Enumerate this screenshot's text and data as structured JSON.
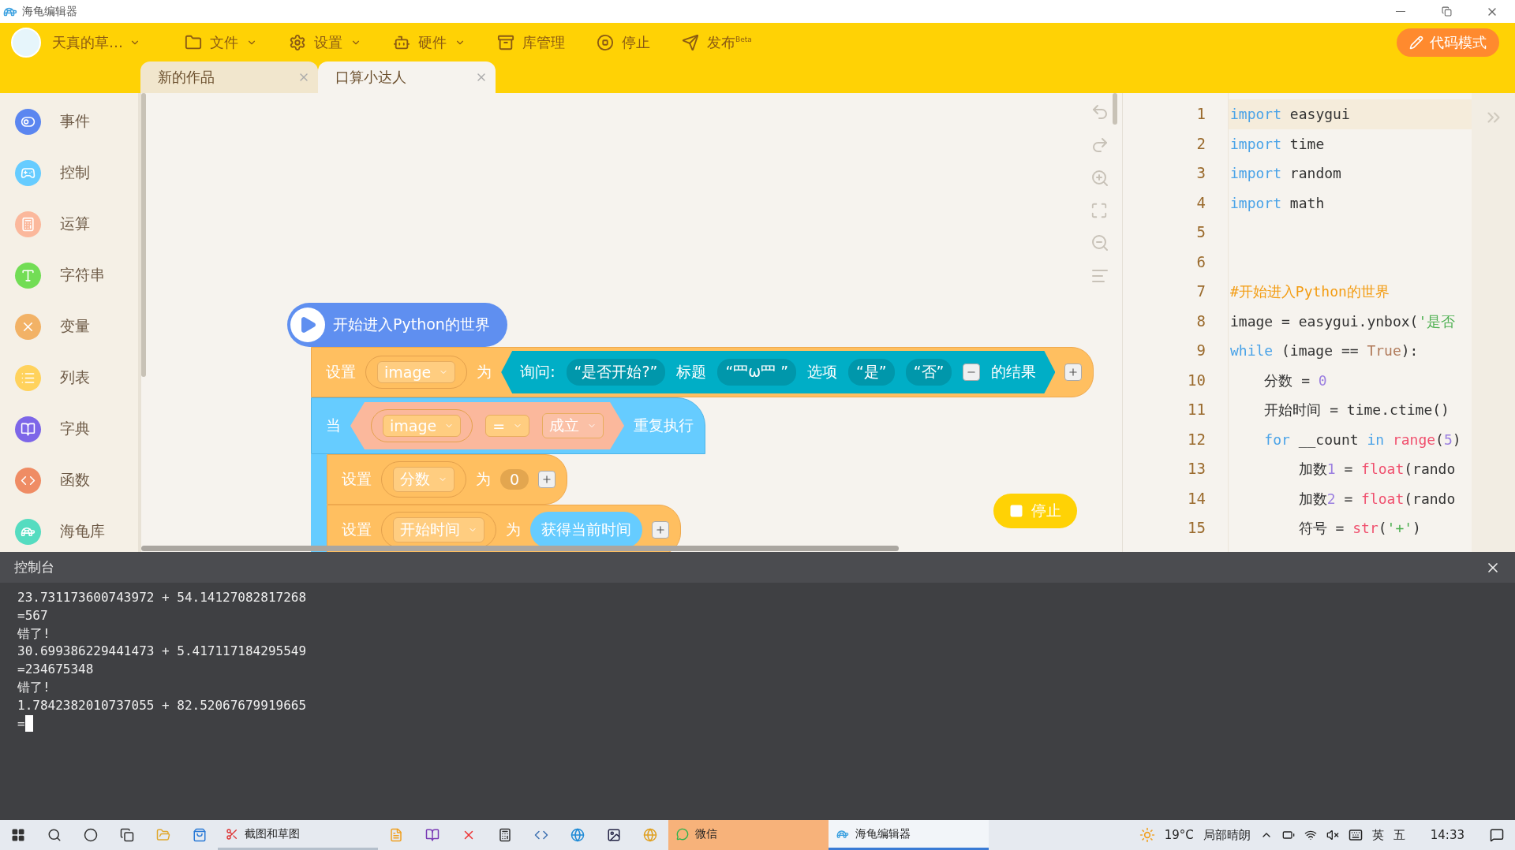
{
  "window": {
    "title": "海龟编辑器"
  },
  "toolbar": {
    "user": "天真的草…",
    "menus": [
      {
        "label": "文件",
        "kind": "dropdown"
      },
      {
        "label": "设置",
        "kind": "dropdown"
      },
      {
        "label": "硬件",
        "kind": "dropdown"
      },
      {
        "label": "库管理",
        "kind": "plain"
      },
      {
        "label": "停止",
        "kind": "plain"
      },
      {
        "label": "发布$^{Beta}$",
        "kind": "plain"
      }
    ],
    "mode_button": "代码模式"
  },
  "tabs": [
    {
      "label": "新的作品",
      "selected": false
    },
    {
      "label": "口算小达人",
      "selected": true
    }
  ],
  "sidebar": {
    "items": [
      {
        "label": "事件",
        "color": "#5b86f0"
      },
      {
        "label": "控制",
        "color": "#66ccff"
      },
      {
        "label": "运算",
        "color": "#fbb89c"
      },
      {
        "label": "字符串",
        "color": "#72dd55"
      },
      {
        "label": "变量",
        "color": "#f2b266"
      },
      {
        "label": "列表",
        "color": "#ffd25c"
      },
      {
        "label": "字典",
        "color": "#7d66e8"
      },
      {
        "label": "函数",
        "color": "#ef8c64"
      },
      {
        "label": "海龟库",
        "color": "#55dcc0"
      }
    ]
  },
  "canvas": {
    "hat": "开始进入Python的世界",
    "set_block": {
      "label": "设置",
      "variable": "image",
      "to": "为",
      "ask": {
        "label": "询问:",
        "prompt": "“是否开始?”",
        "title_label": "标题",
        "title": "“罒ω罒 ”",
        "options_label": "选项",
        "options": [
          "“是”",
          "“否”"
        ],
        "suffix": "的结果"
      }
    },
    "while_block": {
      "label": "当",
      "left": "image",
      "operator": "=",
      "right": "成立",
      "suffix": "重复执行",
      "body": [
        {
          "kind": "number",
          "label": "设置",
          "variable": "分数",
          "to": "为",
          "value": "0"
        },
        {
          "kind": "call",
          "label": "设置",
          "variable": "开始时间",
          "to": "为",
          "value": "获得当前时间"
        }
      ]
    },
    "stop_button": "停止"
  },
  "code": {
    "lines": [
      {
        "number": "1",
        "current": true,
        "tokens": [
          {
            "kind": "keyword",
            "text": "import"
          },
          {
            "kind": "plain",
            "text": " easygui"
          }
        ]
      },
      {
        "number": "2",
        "current": false,
        "tokens": [
          {
            "kind": "keyword",
            "text": "import"
          },
          {
            "kind": "plain",
            "text": " time"
          }
        ]
      },
      {
        "number": "3",
        "current": false,
        "tokens": [
          {
            "kind": "keyword",
            "text": "import"
          },
          {
            "kind": "plain",
            "text": " random"
          }
        ]
      },
      {
        "number": "4",
        "current": false,
        "tokens": [
          {
            "kind": "keyword",
            "text": "import"
          },
          {
            "kind": "plain",
            "text": " math"
          }
        ]
      },
      {
        "number": "5",
        "current": false
      },
      {
        "number": "6",
        "current": false
      },
      {
        "number": "7",
        "current": false,
        "tokens": [
          {
            "kind": "comment",
            "text": "#开始进入Python的世界"
          }
        ]
      },
      {
        "number": "8",
        "current": false,
        "tokens": [
          {
            "kind": "plain",
            "text": "image = easygui.ynbox("
          },
          {
            "kind": "string",
            "text": "'是否"
          }
        ]
      },
      {
        "number": "9",
        "current": false,
        "tokens": [
          {
            "kind": "keyword",
            "text": "while"
          },
          {
            "kind": "plain",
            "text": " (image == "
          },
          {
            "kind": "constant",
            "text": "True"
          },
          {
            "kind": "plain",
            "text": "):"
          }
        ]
      },
      {
        "number": "10",
        "current": false,
        "tokens": [
          {
            "kind": "plain",
            "text": "    分数 = "
          },
          {
            "kind": "number",
            "text": "0"
          }
        ]
      },
      {
        "number": "11",
        "current": false,
        "tokens": [
          {
            "kind": "plain",
            "text": "    开始时间 = time.ctime()"
          }
        ]
      },
      {
        "number": "12",
        "current": false,
        "tokens": [
          {
            "kind": "keyword",
            "text": "    for"
          },
          {
            "kind": "plain",
            "text": " __count "
          },
          {
            "kind": "keyword",
            "text": "in "
          },
          {
            "kind": "builtin",
            "text": "range"
          },
          {
            "kind": "plain",
            "text": "("
          },
          {
            "kind": "number",
            "text": "5"
          },
          {
            "kind": "plain",
            "text": ")"
          }
        ]
      },
      {
        "number": "13",
        "current": false,
        "tokens": [
          {
            "kind": "plain",
            "text": "        加数"
          },
          {
            "kind": "number",
            "text": "1"
          },
          {
            "kind": "plain",
            "text": " = "
          },
          {
            "kind": "builtin",
            "text": "float"
          },
          {
            "kind": "plain",
            "text": "(rando"
          }
        ]
      },
      {
        "number": "14",
        "current": false,
        "tokens": [
          {
            "kind": "plain",
            "text": "        加数"
          },
          {
            "kind": "number",
            "text": "2"
          },
          {
            "kind": "plain",
            "text": " = "
          },
          {
            "kind": "builtin",
            "text": "float"
          },
          {
            "kind": "plain",
            "text": "(rando"
          }
        ]
      },
      {
        "number": "15",
        "current": false,
        "tokens": [
          {
            "kind": "plain",
            "text": "        符号 = "
          },
          {
            "kind": "builtin",
            "text": "str"
          },
          {
            "kind": "plain",
            "text": "("
          },
          {
            "kind": "string",
            "text": "'+'"
          },
          {
            "kind": "plain",
            "text": ")"
          }
        ]
      }
    ]
  },
  "console": {
    "title": "控制台",
    "lines": [
      "23.731173600743972 + 54.14127082817268",
      "=567",
      "错了!",
      "30.699386229441473 + 5.417117184295549",
      "=234675348",
      "错了!",
      "1.7842382010737055 + 82.52067679919665",
      "="
    ]
  },
  "taskbar": {
    "apps": [
      {
        "label": "截图和草图",
        "selected": false,
        "highlighted": false
      },
      {
        "label": "微信",
        "selected": false,
        "highlighted": true
      },
      {
        "label": "海龟编辑器",
        "selected": true,
        "highlighted": false
      }
    ],
    "weather": {
      "temperature": "19°C",
      "condition": "局部晴朗"
    },
    "ime": "英",
    "ime_mode": "五",
    "clock": "14:33"
  }
}
